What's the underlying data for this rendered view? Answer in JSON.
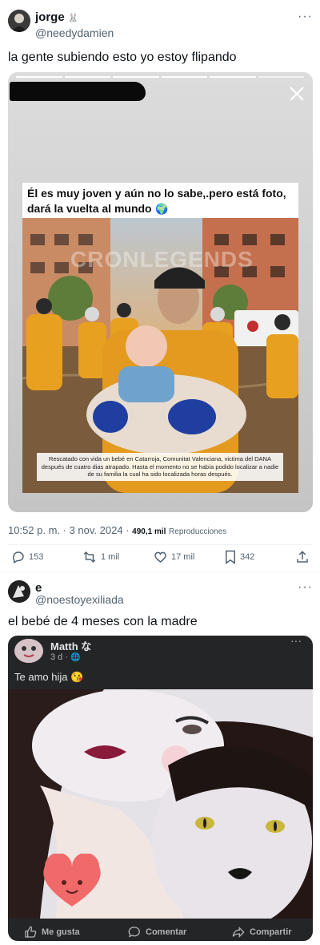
{
  "tweet1": {
    "display_name": "jorge",
    "handle": "@needydamien",
    "more": "···",
    "text": "la gente subiendo esto yo estoy flipando",
    "story": {
      "headline": "Él es muy joven y aún no lo sabe,.pero está foto, dará la vuelta al mundo",
      "caption": "Rescatado con vida un bebé en Catarroja, Comunitat Valenciana, victima del DANA después de cuatro dias atrapado. Hasta el momento no se había podido localizar a nadie de su familia la cual ha sido localizada horas después.",
      "watermark": "CRONLEGENDS"
    },
    "time": "10:52 p. m. · 3 nov. 2024 ·",
    "views_count": "490,1 mil",
    "views_label": "Reproducciones",
    "actions": {
      "replies": "153",
      "retweets": "1 mil",
      "likes": "17 mil",
      "bookmarks": "342"
    }
  },
  "tweet2": {
    "display_name": "e",
    "handle": "@noestoyexiliada",
    "more": "···",
    "text": "el bebé de 4 meses con la madre",
    "fb_post": {
      "author": "Matth な",
      "meta": "3 d · ",
      "more": "···",
      "text": "Te amo hija",
      "like_label": "Me gusta",
      "comment_label": "Comentar",
      "share_label": "Compartir"
    }
  },
  "colors": {
    "text_primary": "#0f1419",
    "text_secondary": "#536471",
    "divider": "#eff3f4",
    "fb_background": "#242526"
  }
}
